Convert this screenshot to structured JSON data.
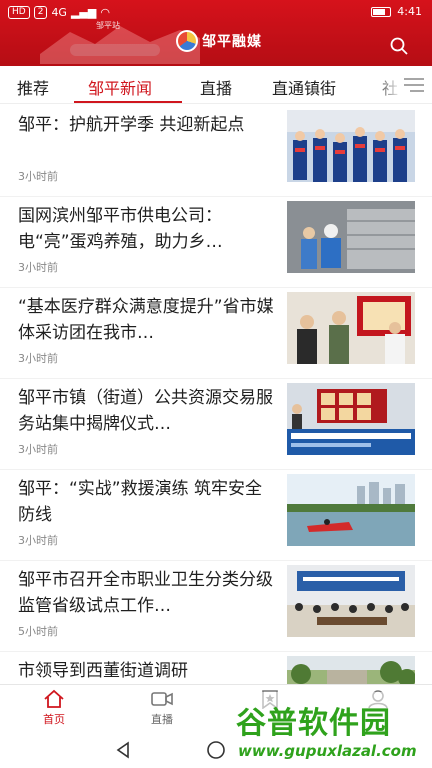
{
  "status_bar": {
    "sim_badge": "HD",
    "sim_number": "2",
    "network": "4G",
    "battery": "",
    "time": "4:41",
    "station_text": "邹平站"
  },
  "header": {
    "brand": "邹平融媒",
    "search_icon": "search-icon"
  },
  "tabs": [
    {
      "label": "推荐"
    },
    {
      "label": "邹平新闻"
    },
    {
      "label": "直播"
    },
    {
      "label": "直通镇街"
    },
    {
      "label": "社"
    }
  ],
  "active_tab": "邹平新闻",
  "news": [
    {
      "title": "邹平：护航开学季 共迎新起点",
      "time": "3小时前"
    },
    {
      "title": "国网滨州邹平市供电公司：电“亮”蛋鸡养殖，助力乡…",
      "time": "3小时前"
    },
    {
      "title": "“基本医疗群众满意度提升”省市媒体采访团在我市…",
      "time": "3小时前"
    },
    {
      "title": "邹平市镇（街道）公共资源交易服务站集中揭牌仪式…",
      "time": "3小时前"
    },
    {
      "title": "邹平：“实战”救援演练 筑牢安全防线",
      "time": "3小时前"
    },
    {
      "title": "邹平市召开全市职业卫生分类分级监管省级试点工作…",
      "time": "5小时前"
    },
    {
      "title": "市领导到西董街道调研",
      "time": ""
    }
  ],
  "bottom_nav": [
    {
      "label": "首页",
      "icon": "home-icon"
    },
    {
      "label": "直播",
      "icon": "video-camera-icon"
    },
    {
      "label": "",
      "icon": "bookmark-star-icon"
    },
    {
      "label": "",
      "icon": "user-icon"
    }
  ],
  "watermark": {
    "name": "谷普软件园",
    "url": "www.gupuxlazal.com"
  },
  "colors": {
    "brand_red": "#d0161e",
    "header_red": "#c20f17",
    "watermark_green": "#2fa21c"
  }
}
